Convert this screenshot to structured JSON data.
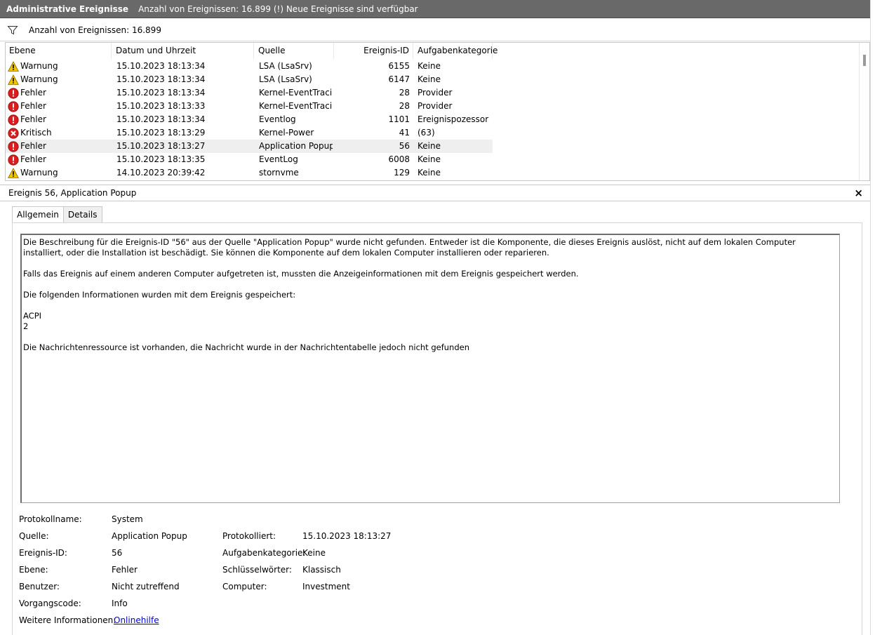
{
  "window": {
    "title": "Administrative Ereignisse",
    "subtitle": "Anzahl von Ereignissen: 16.899 (!) Neue Ereignisse sind verfügbar"
  },
  "filter": {
    "icon": "filter-icon",
    "text": "Anzahl von Ereignissen: 16.899"
  },
  "list": {
    "columns": [
      "Ebene",
      "Datum und Uhrzeit",
      "Quelle",
      "Ereignis-ID",
      "Aufgabenkategorie"
    ],
    "rows": [
      {
        "level": "Warnung",
        "icon": "warning-icon",
        "date": "15.10.2023 18:13:34",
        "source": "LSA (LsaSrv)",
        "id": "6155",
        "category": "Keine"
      },
      {
        "level": "Warnung",
        "icon": "warning-icon",
        "date": "15.10.2023 18:13:34",
        "source": "LSA (LsaSrv)",
        "id": "6147",
        "category": "Keine"
      },
      {
        "level": "Fehler",
        "icon": "error-icon",
        "date": "15.10.2023 18:13:34",
        "source": "Kernel-EventTraci...",
        "id": "28",
        "category": "Provider"
      },
      {
        "level": "Fehler",
        "icon": "error-icon",
        "date": "15.10.2023 18:13:33",
        "source": "Kernel-EventTraci...",
        "id": "28",
        "category": "Provider"
      },
      {
        "level": "Fehler",
        "icon": "error-icon",
        "date": "15.10.2023 18:13:34",
        "source": "Eventlog",
        "id": "1101",
        "category": "Ereignispozessor"
      },
      {
        "level": "Kritisch",
        "icon": "critical-icon",
        "date": "15.10.2023 18:13:29",
        "source": "Kernel-Power",
        "id": "41",
        "category": "(63)"
      },
      {
        "level": "Fehler",
        "icon": "error-icon",
        "date": "15.10.2023 18:13:27",
        "source": "Application Popup",
        "id": "56",
        "category": "Keine",
        "selected": true
      },
      {
        "level": "Fehler",
        "icon": "error-icon",
        "date": "15.10.2023 18:13:35",
        "source": "EventLog",
        "id": "6008",
        "category": "Keine"
      },
      {
        "level": "Warnung",
        "icon": "warning-icon",
        "date": "14.10.2023 20:39:42",
        "source": "stornvme",
        "id": "129",
        "category": "Keine"
      }
    ]
  },
  "detail": {
    "title": "Ereignis 56, Application Popup",
    "close_label": "×",
    "tabs": [
      "Allgemein",
      "Details"
    ],
    "description": [
      "Die Beschreibung für die Ereignis-ID \"56\" aus der Quelle \"Application Popup\" wurde nicht gefunden. Entweder ist die Komponente, die dieses Ereignis auslöst, nicht auf dem lokalen Computer installiert, oder die Installation ist beschädigt. Sie können die Komponente auf dem lokalen Computer installieren oder reparieren.",
      "",
      "Falls das Ereignis auf einem anderen Computer aufgetreten ist, mussten die Anzeigeinformationen mit dem Ereignis gespeichert werden.",
      "",
      "Die folgenden Informationen wurden mit dem Ereignis gespeichert:",
      "",
      "ACPI",
      "2",
      "",
      "Die Nachrichtenressource ist vorhanden, die Nachricht wurde in der Nachrichtentabelle jedoch nicht gefunden"
    ],
    "properties": {
      "protokollname_label": "Protokollname:",
      "protokollname": "System",
      "quelle_label": "Quelle:",
      "quelle": "Application Popup",
      "protokolliert_label": "Protokolliert:",
      "protokolliert": "15.10.2023 18:13:27",
      "ereignis_id_label": "Ereignis-ID:",
      "ereignis_id": "56",
      "aufgabenkategorie_label": "Aufgabenkategorie:",
      "aufgabenkategorie": "Keine",
      "ebene_label": "Ebene:",
      "ebene": "Fehler",
      "schluesselwoerter_label": "Schlüsselwörter:",
      "schluesselwoerter": "Klassisch",
      "benutzer_label": "Benutzer:",
      "benutzer": "Nicht zutreffend",
      "computer_label": "Computer:",
      "computer": "Investment",
      "vorgangscode_label": "Vorgangscode:",
      "vorgangscode": "Info",
      "weitere_label": "Weitere Informationen:",
      "weitere_link": "Onlinehilfe"
    }
  },
  "colors": {
    "titlebar": "#696969",
    "warning": "#f5c400",
    "error": "#d81e1e",
    "selected_row": "#efefef",
    "link": "#0000ee"
  }
}
